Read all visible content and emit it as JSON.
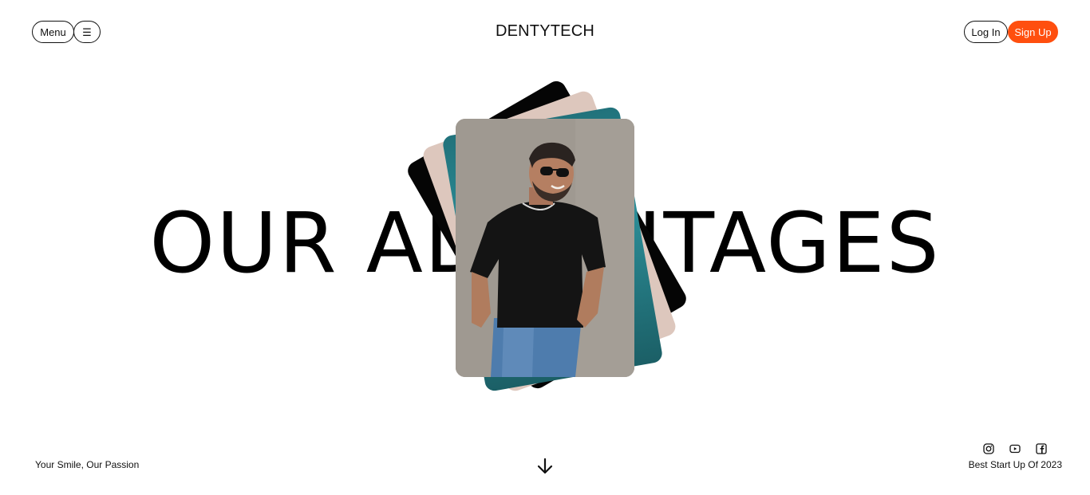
{
  "header": {
    "menu_label": "Menu",
    "burger_glyph": "☰",
    "logo": "DENTYTECH",
    "login_label": "Log In",
    "signup_label": "Sign Up"
  },
  "hero": {
    "headline": "OUR ADVANTAGES"
  },
  "footer": {
    "tagline": "Your Smile, Our Passion",
    "scroll_icon": "arrow-down-icon",
    "socials": [
      "instagram-icon",
      "youtube-icon",
      "facebook-icon"
    ],
    "award": "Best Start Up Of 2023"
  },
  "colors": {
    "accent": "#ff4f0f",
    "text": "#111111",
    "card_black": "#050505",
    "card_beige": "#ddc7bd",
    "card_teal": "#21727b"
  }
}
